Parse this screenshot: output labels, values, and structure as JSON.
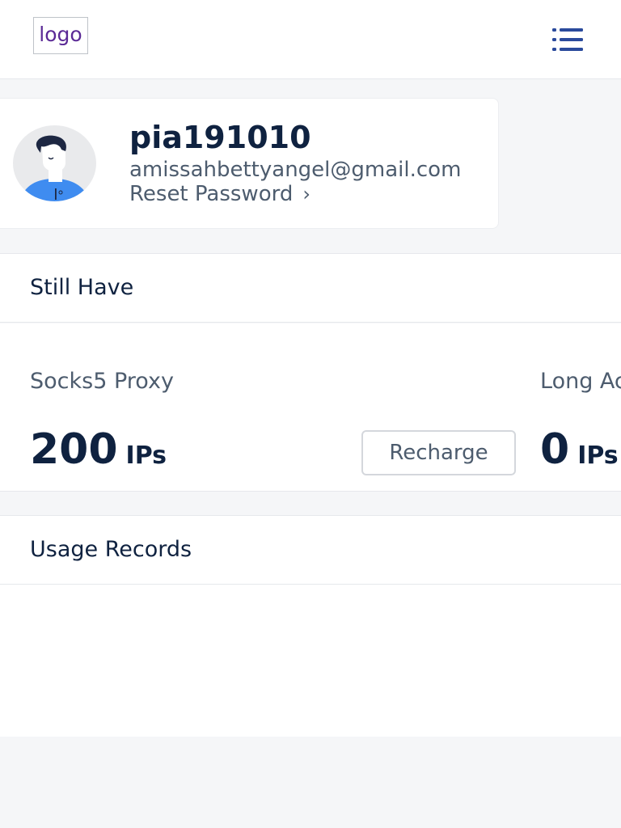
{
  "header": {
    "logo_text": "logo",
    "menu_icon": "list-menu-icon",
    "accent_color": "#2a4a9c"
  },
  "profile": {
    "avatar_icon": "user-avatar-icon",
    "username": "pia191010",
    "email": "amissahbettyangel@gmail.com",
    "reset_label": "Reset Password",
    "reset_chevron": "›"
  },
  "still_have": {
    "title": "Still Have"
  },
  "proxies": [
    {
      "name": "Socks5 Proxy",
      "count": "200",
      "unit": "IPs",
      "button_label": "Recharge"
    },
    {
      "name": "Long Ac",
      "count": "0",
      "unit": "IPs"
    }
  ],
  "usage_records": {
    "title": "Usage Records"
  }
}
